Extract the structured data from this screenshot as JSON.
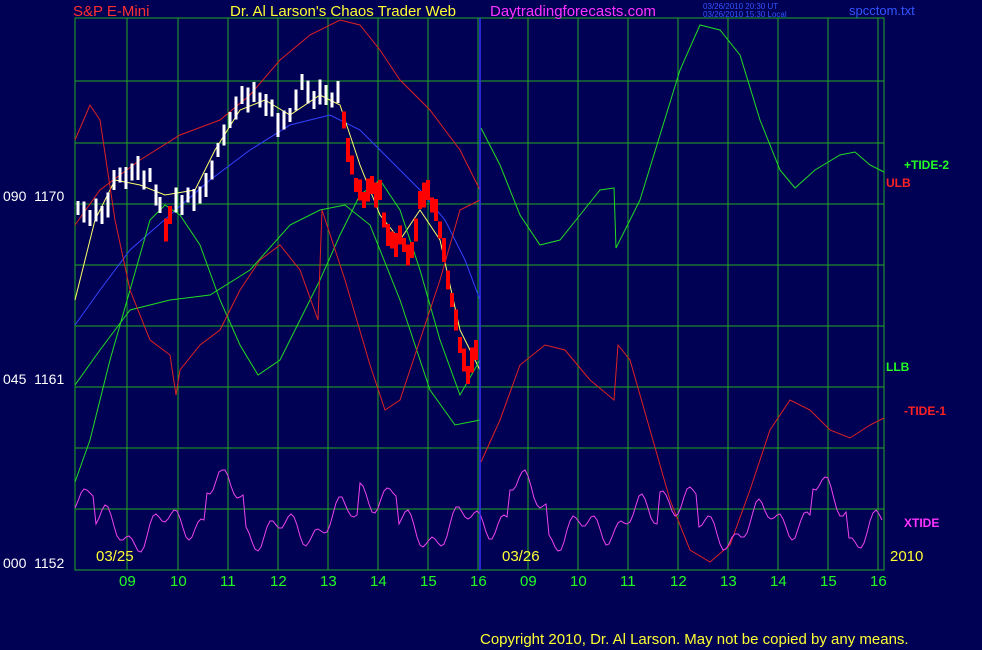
{
  "header": {
    "instrument": "S&P E-Mini",
    "title": "Dr. Al Larson's Chaos Trader Web",
    "site": "Daytradingforecasts.com",
    "ut_stamp": "03/26/2010 20:30 UT",
    "local_stamp": "03/26/2010 15:30 Local",
    "filename": "spcctom.txt"
  },
  "y_axis": {
    "labels": [
      {
        "code": "090",
        "price": "1170"
      },
      {
        "code": "045",
        "price": "1161"
      },
      {
        "code": "000",
        "price": "1152"
      }
    ]
  },
  "x_axis": {
    "hours": [
      "09",
      "10",
      "11",
      "12",
      "13",
      "14",
      "15",
      "16",
      "09",
      "10",
      "11",
      "12",
      "13",
      "14",
      "15",
      "16"
    ],
    "date1": "03/25",
    "date2": "03/26",
    "year": "2010"
  },
  "legend": {
    "tide2": "+TIDE-2",
    "ulb": "ULB",
    "llb": "LLB",
    "tide1": "-TIDE-1",
    "xtide": "XTIDE"
  },
  "footer": {
    "copyright": "Copyright 2010, Dr. Al Larson. May not be copied by any means."
  },
  "colors": {
    "background": "#000055",
    "grid": "#22aa22",
    "price_up": "#ffffff",
    "price_down": "#ff0000",
    "tide2": "#22dd22",
    "tide1": "#dd2222",
    "xtide": "#ee44ee",
    "ma_fast": "#ffff66",
    "ma_slow": "#3344ff",
    "cursor": "#3333ff"
  },
  "chart_data": {
    "type": "line",
    "y_range": [
      1152,
      1176
    ],
    "y_ticks": [
      1152,
      1161,
      1170
    ],
    "series": [
      {
        "name": "+TIDE-2",
        "x": [
          0,
          1,
          2,
          3,
          4,
          5,
          6,
          7,
          8,
          9,
          10,
          11,
          12,
          13,
          14,
          15,
          16
        ],
        "values": [
          1154,
          1160,
          1165,
          1166,
          1170,
          1171,
          1166,
          1164,
          1172,
          1168,
          1169,
          1170,
          1176,
          1171,
          1170,
          1171,
          1170
        ]
      },
      {
        "name": "-TIDE-1",
        "x": [
          0,
          1,
          2,
          3,
          4,
          5,
          6,
          7,
          8,
          9,
          10,
          11,
          12,
          13,
          14,
          15,
          16
        ],
        "values": [
          1173,
          1163,
          1165,
          1168,
          1175,
          1172,
          1169,
          1170,
          1156,
          1161,
          1161,
          1160,
          1152,
          1154,
          1160,
          1158,
          1159
        ]
      },
      {
        "name": "XTIDE",
        "x": [
          0,
          2,
          4,
          6,
          8,
          10,
          12,
          14,
          16
        ],
        "values": [
          1153,
          1155,
          1153,
          1156,
          1153,
          1155,
          1153,
          1155,
          1153
        ]
      }
    ]
  }
}
